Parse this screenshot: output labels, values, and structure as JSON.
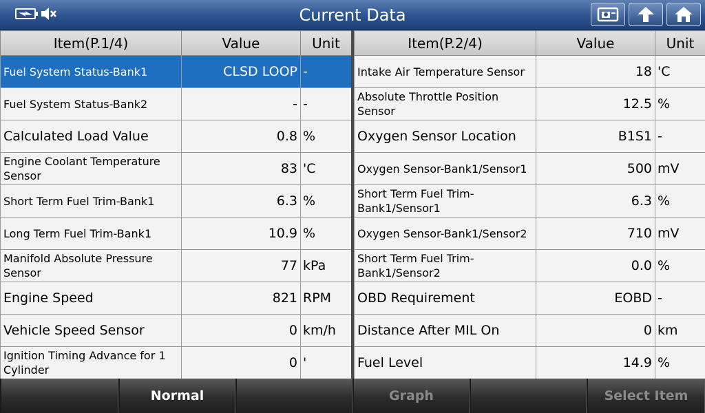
{
  "title": "Current Data",
  "left_table": {
    "headers": {
      "item": "Item(P.1/4)",
      "value": "Value",
      "unit": "Unit"
    },
    "rows": [
      {
        "item": "Fuel System Status-Bank1",
        "value": "CLSD LOOP",
        "unit": "-"
      },
      {
        "item": "Fuel System Status-Bank2",
        "value": "-",
        "unit": "-"
      },
      {
        "item": "Calculated Load Value",
        "value": "0.8",
        "unit": "%"
      },
      {
        "item": "Engine Coolant Temperature Sensor",
        "value": "83",
        "unit": "'C"
      },
      {
        "item": "Short Term Fuel Trim-Bank1",
        "value": "6.3",
        "unit": "%"
      },
      {
        "item": "Long Term Fuel Trim-Bank1",
        "value": "10.9",
        "unit": "%"
      },
      {
        "item": "Manifold Absolute Pressure Sensor",
        "value": "77",
        "unit": "kPa"
      },
      {
        "item": "Engine Speed",
        "value": "821",
        "unit": "RPM"
      },
      {
        "item": "Vehicle Speed Sensor",
        "value": "0",
        "unit": "km/h"
      },
      {
        "item": "Ignition Timing Advance for 1 Cylinder",
        "value": "0",
        "unit": "'"
      }
    ]
  },
  "right_table": {
    "headers": {
      "item": "Item(P.2/4)",
      "value": "Value",
      "unit": "Unit"
    },
    "rows": [
      {
        "item": "Intake Air Temperature Sensor",
        "value": "18",
        "unit": "'C"
      },
      {
        "item": "Absolute Throttle Position Sensor",
        "value": "12.5",
        "unit": "%"
      },
      {
        "item": "Oxygen Sensor Location",
        "value": "B1S1",
        "unit": "-"
      },
      {
        "item": "Oxygen Sensor-Bank1/Sensor1",
        "value": "500",
        "unit": "mV"
      },
      {
        "item": "Short Term Fuel Trim-Bank1/Sensor1",
        "value": "6.3",
        "unit": "%"
      },
      {
        "item": "Oxygen Sensor-Bank1/Sensor2",
        "value": "710",
        "unit": "mV"
      },
      {
        "item": "Short Term Fuel Trim-Bank1/Sensor2",
        "value": "0.0",
        "unit": "%"
      },
      {
        "item": "OBD Requirement",
        "value": "EOBD",
        "unit": "-"
      },
      {
        "item": "Distance After MIL On",
        "value": "0",
        "unit": "km"
      },
      {
        "item": "Fuel Level",
        "value": "14.9",
        "unit": "%"
      }
    ]
  },
  "bottom_buttons": {
    "b1": "",
    "b2": "Normal",
    "b3": "",
    "b4": "Graph",
    "b5": "",
    "b6": "Select Item"
  },
  "icons": {
    "battery": "battery-charging-icon",
    "mute": "speaker-mute-icon",
    "screenshot": "screenshot-icon",
    "back": "back-arrow-icon",
    "home": "home-icon"
  },
  "colors": {
    "title_bar": "#2f5691",
    "selected_row": "#1f6fc0",
    "disabled_text": "#8a8a8a"
  }
}
